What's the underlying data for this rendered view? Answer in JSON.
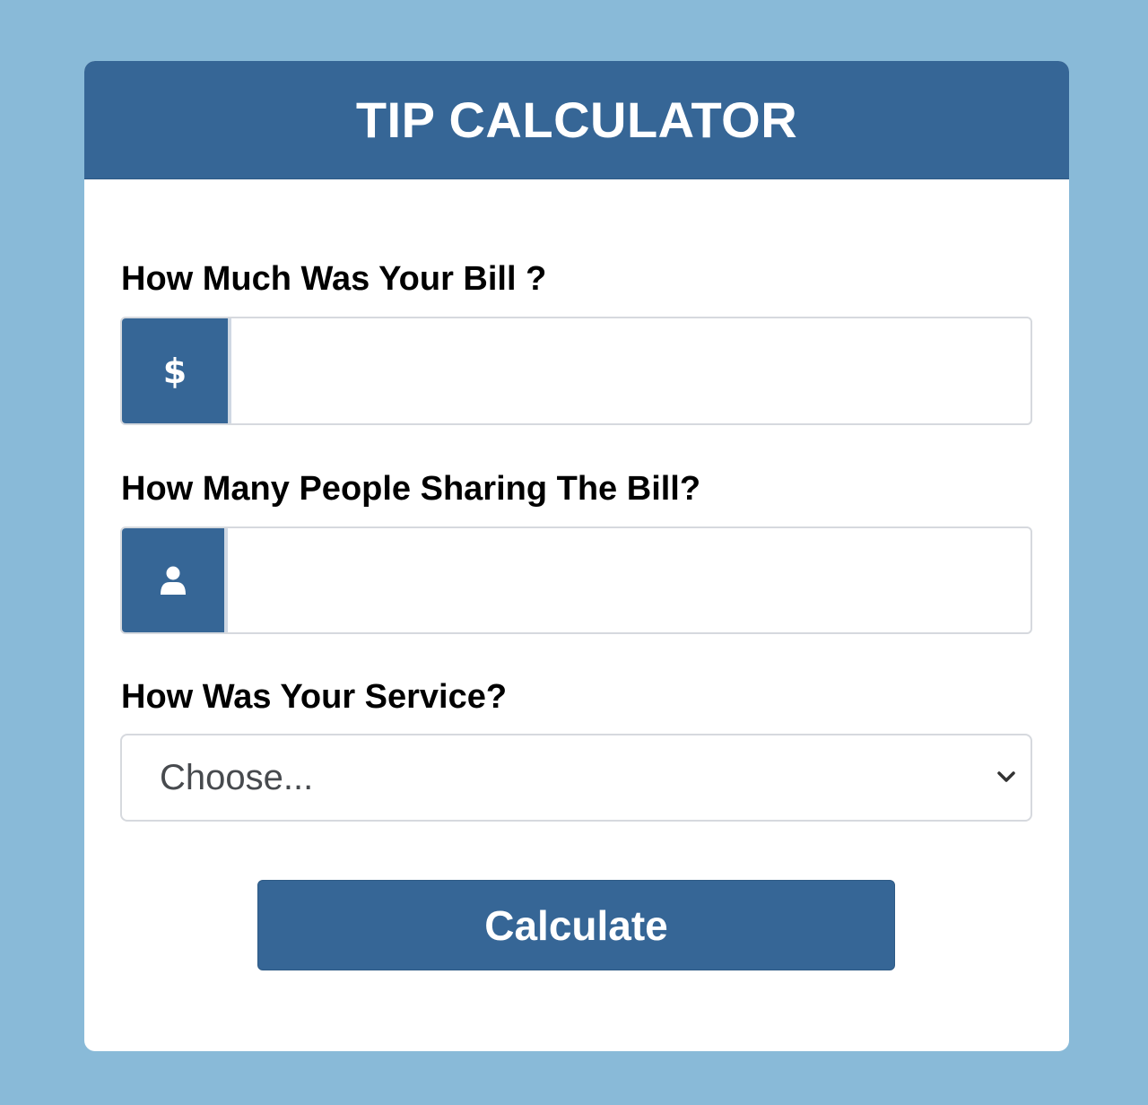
{
  "app": {
    "title": "TIP CALCULATOR"
  },
  "form": {
    "bill": {
      "label": "How Much Was Your Bill ?",
      "addon_symbol": "$",
      "addon_icon": "dollar-icon",
      "value": "",
      "placeholder": ""
    },
    "people": {
      "label": "How Many People Sharing The Bill?",
      "addon_icon": "person-icon",
      "value": "",
      "placeholder": ""
    },
    "service": {
      "label": "How Was Your Service?",
      "selected": "Choose...",
      "dropdown_icon": "chevron-down-icon"
    },
    "submit_label": "Calculate"
  },
  "colors": {
    "background": "#89bad8",
    "accent": "#366696",
    "card": "#ffffff"
  }
}
